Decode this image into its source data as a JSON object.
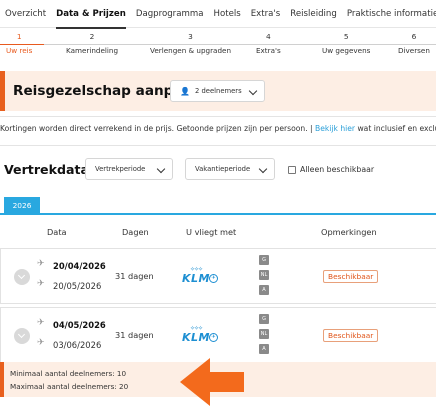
{
  "tabs": [
    {
      "label": "Overzicht",
      "active": false
    },
    {
      "label": "Data & Prijzen",
      "active": true
    },
    {
      "label": "Dagprogramma",
      "active": false
    },
    {
      "label": "Hotels",
      "active": false
    },
    {
      "label": "Extra's",
      "active": false
    },
    {
      "label": "Reisleiding",
      "active": false
    },
    {
      "label": "Praktische informatie",
      "active": false
    }
  ],
  "steps": [
    {
      "num": "1",
      "label": "Uw reis",
      "active": true
    },
    {
      "num": "2",
      "label": "Kamerindeling",
      "active": false
    },
    {
      "num": "3",
      "label": "Verlengen & upgraden",
      "active": false
    },
    {
      "num": "4",
      "label": "Extra's",
      "active": false
    },
    {
      "num": "5",
      "label": "Uw gegevens",
      "active": false
    },
    {
      "num": "6",
      "label": "Diversen",
      "active": false
    }
  ],
  "banner": {
    "title": "Reisgezelschap aanpassen",
    "participants_value": "2 deelnemers"
  },
  "discount": {
    "text_before": "Kortingen worden direct verrekend in de prijs. Getoonde prijzen zijn per persoon. | ",
    "link": "Bekijk hier",
    "text_after": " wat inclusief en exclus"
  },
  "departures": {
    "title": "Vertrekdata",
    "period_value": "Vertrekperiode",
    "holiday_value": "Vakantieperiode",
    "available_only_label": "Alleen beschikbaar",
    "year_tab": "2026"
  },
  "table": {
    "headers": {
      "date": "Data",
      "days": "Dagen",
      "airline": "U vliegt met",
      "remarks": "Opmerkingen"
    },
    "rows": [
      {
        "depart": "20/04/2026",
        "return": "20/05/2026",
        "days": "31 dagen",
        "airline": "KLM",
        "badges": [
          "G",
          "NL",
          "A"
        ],
        "status": "Beschikbaar"
      },
      {
        "depart": "04/05/2026",
        "return": "03/06/2026",
        "days": "31 dagen",
        "airline": "KLM",
        "badges": [
          "G",
          "NL",
          "A"
        ],
        "status": "Beschikbaar"
      }
    ]
  },
  "info": {
    "min_line": "Minimaal aantal deelnemers: 10",
    "max_line": "Maximaal aantal deelnemers: 20"
  },
  "colors": {
    "accent": "#e8601e",
    "blue": "#29a8e0",
    "banner_bg": "#fdeee4"
  }
}
